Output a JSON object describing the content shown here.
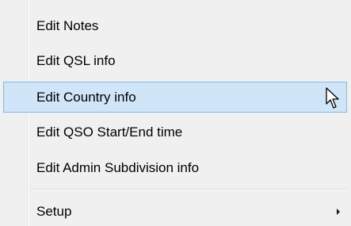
{
  "menu": {
    "items": [
      {
        "label": "Edit Notes"
      },
      {
        "label": "Edit QSL info"
      },
      {
        "label": "Edit Country info",
        "highlighted": true
      },
      {
        "label": "Edit QSO Start/End time"
      },
      {
        "label": "Edit Admin Subdivision info"
      },
      {
        "label": "Setup",
        "has_submenu": true
      }
    ]
  },
  "colors": {
    "menu_background": "#f0f0f0",
    "highlight_fill": "#d0e5f8",
    "highlight_border": "#88b7e0"
  },
  "icons": {
    "submenu": "chevron-right-icon",
    "cursor": "mouse-pointer-icon"
  }
}
